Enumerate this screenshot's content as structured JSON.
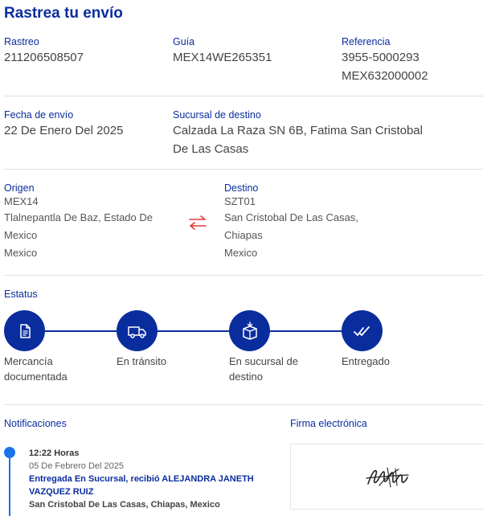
{
  "header": {
    "title": "Rastrea tu envío"
  },
  "ids": {
    "rastreo_label": "Rastreo",
    "rastreo_value": "211206508507",
    "guia_label": "Guía",
    "guia_value": "MEX14WE265351",
    "referencia_label": "Referencia",
    "referencia_lines": [
      "3955-5000293",
      "MEX632000002"
    ]
  },
  "shipment": {
    "fecha_label": "Fecha de envío",
    "fecha_value": "22 De Enero Del 2025",
    "sucursal_label": "Sucursal de destino",
    "sucursal_lines": [
      "Calzada La Raza SN 6B, Fatima San Cristobal",
      "De Las Casas"
    ]
  },
  "route": {
    "origen_label": "Origen",
    "origen_code": "MEX14",
    "origen_lines": [
      "Tlalnepantla De Baz, Estado De",
      "Mexico",
      "Mexico"
    ],
    "destino_label": "Destino",
    "destino_code": "SZT01",
    "destino_lines": [
      "San Cristobal De Las Casas,",
      "Chiapas",
      "Mexico"
    ],
    "swap_icon": "swap-arrows-icon",
    "swap_color": "#e53935"
  },
  "status": {
    "label": "Estatus",
    "accent": "#0a2d9e",
    "steps": [
      {
        "label_lines": [
          "Mercancía",
          "documentada"
        ],
        "icon": "document-icon"
      },
      {
        "label_lines": [
          "En tránsito"
        ],
        "icon": "truck-icon"
      },
      {
        "label_lines": [
          "En sucursal de",
          "destino"
        ],
        "icon": "package-icon"
      },
      {
        "label_lines": [
          "Entregado"
        ],
        "icon": "double-check-icon"
      }
    ]
  },
  "notifications": {
    "label": "Notificaciones",
    "items": [
      {
        "time": "12:22 Horas",
        "date": "05 De Febrero Del 2025",
        "event_lines": [
          "Entregada En Sucursal, recibió ALEJANDRA JANETH",
          "VAZQUEZ RUIZ"
        ],
        "place": "San Cristobal De Las Casas, Chiapas, Mexico"
      }
    ],
    "dot_color": "#1a73e8"
  },
  "signature": {
    "label": "Firma electrónica"
  }
}
